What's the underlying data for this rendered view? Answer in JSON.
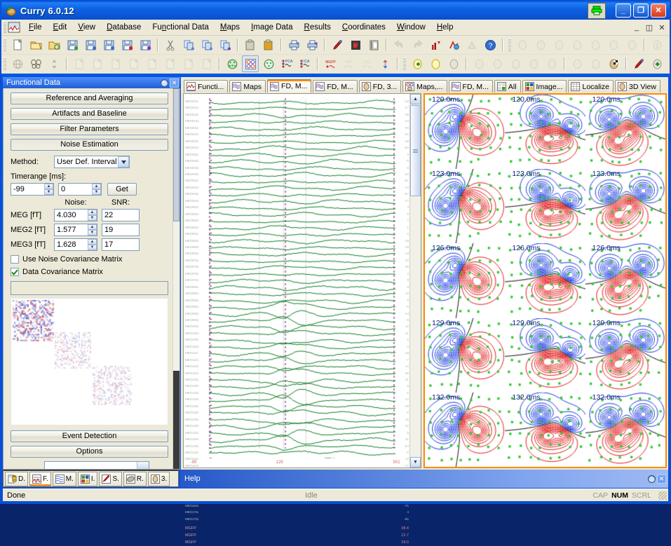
{
  "window": {
    "title": "Curry 6.0.12",
    "icon": "curry-app-icon",
    "print_icon": "printer-icon",
    "minimize": "_",
    "maximize": "❐",
    "close": "✕"
  },
  "menu": {
    "app_icon": "curry-document-icon",
    "items": [
      {
        "label": "File",
        "accel": "F"
      },
      {
        "label": "Edit",
        "accel": "E"
      },
      {
        "label": "View",
        "accel": "V"
      },
      {
        "label": "Database",
        "accel": "D"
      },
      {
        "label": "Functional Data",
        "accel": "n"
      },
      {
        "label": "Maps",
        "accel": "M"
      },
      {
        "label": "Image Data",
        "accel": "I"
      },
      {
        "label": "Results",
        "accel": "R"
      },
      {
        "label": "Coordinates",
        "accel": "C"
      },
      {
        "label": "Window",
        "accel": "W"
      },
      {
        "label": "Help",
        "accel": "H"
      }
    ],
    "window_buttons": [
      "_",
      "❐",
      "✕"
    ]
  },
  "toolbar_row1": [
    "new-document-icon",
    "open-folder-icon",
    "open-search-icon",
    "save-green-icon",
    "save-blue-icon",
    "save-blue2-icon",
    "save-red-icon",
    "save-purple-icon",
    "cut-icon",
    "copy-icon",
    "copy2-icon",
    "copy-purple-icon",
    "paste-icon",
    "paste-gold-icon",
    "print-icon",
    "print-purple-icon",
    "marker-icon",
    "red-hand-icon",
    "filmstrip-icon",
    "undo-icon",
    "redo-icon",
    "chart-red-icon",
    "chart-blue-icon",
    "chart-gray-icon",
    "help-icon",
    "head-rotate-icon",
    "head1-icon",
    "head2-icon",
    "head3-icon",
    "head4-icon",
    "head5-icon",
    "head6-icon",
    "head-num1-icon",
    "head-num2-icon",
    "head-pair1-icon",
    "head-pair2-icon"
  ],
  "toolbar_row2": [
    "globe-gray-icon",
    "butterfly-icon",
    "updown-icon",
    "page-blank-icon",
    "page-left-icon",
    "page-x-icon",
    "page-right-icon",
    "page-dots-icon",
    "page-a-icon",
    "page-b-icon",
    "page-c-icon",
    "sensor-globe-icon",
    "maps-2x2-icon",
    "sensor-green-icon",
    "pca-icon",
    "ica-icon",
    "mgfp-icon",
    "dip-icon",
    "dev-icon",
    "updown-blue-icon",
    "head-plus-yellow-icon",
    "head-yellow-icon",
    "head-x-icon",
    "head-grid1-icon",
    "head-grid2-icon",
    "head-grid3-icon",
    "head-grid4-icon",
    "head-grid5-icon",
    "head-slice1-icon",
    "head-slice2-icon",
    "head-checker-icon",
    "head-marker-icon",
    "head-add-icon",
    "head-pink-icon"
  ],
  "panel": {
    "title": "Functional Data",
    "title_icon": "sphere-icon",
    "close_label": "✕",
    "buttons": [
      {
        "label": "Reference and Averaging",
        "state": "normal"
      },
      {
        "label": "Artifacts and Baseline",
        "state": "normal"
      },
      {
        "label": "Filter Parameters",
        "state": "normal"
      },
      {
        "label": "Noise Estimation",
        "state": "pressed"
      }
    ],
    "method": {
      "label": "Method:",
      "value": "User Def. Interval",
      "dropdown_icon": "chevron-down-icon"
    },
    "timerange": {
      "label": "Timerange [ms]:",
      "from": "-99",
      "to": "0",
      "get_label": "Get"
    },
    "table": {
      "col_noise": "Noise:",
      "col_snr": "SNR:",
      "rows": [
        {
          "label": "MEG [fT]",
          "noise": "4.030",
          "snr": "22"
        },
        {
          "label": "MEG2 [fT]",
          "noise": "1.577",
          "snr": "19"
        },
        {
          "label": "MEG3 [fT]",
          "noise": "1.628",
          "snr": "17"
        }
      ]
    },
    "checkboxes": [
      {
        "label": "Use Noise Covariance Matrix",
        "checked": false
      },
      {
        "label": "Data Covariance Matrix",
        "checked": true
      }
    ],
    "bottom_buttons": [
      {
        "label": "Event Detection"
      },
      {
        "label": "Options"
      }
    ]
  },
  "view_tabs": [
    {
      "label": "Functi...",
      "icon": "functional-data-icon",
      "active": false
    },
    {
      "label": "Maps",
      "icon": "maps-icon",
      "active": false
    },
    {
      "label": "FD, M...",
      "icon": "fd-maps-icon",
      "active": true
    },
    {
      "label": "FD, M...",
      "icon": "fd-maps2-icon",
      "active": false
    },
    {
      "label": "FD, 3...",
      "icon": "fd-3d-icon",
      "active": false
    },
    {
      "label": "Maps,...",
      "icon": "maps-3d-icon",
      "active": false
    },
    {
      "label": "FD, M...",
      "icon": "fd-maps3-icon",
      "active": false
    },
    {
      "label": "All",
      "icon": "all-icon",
      "active": false
    },
    {
      "label": "Image...",
      "icon": "image-data-icon",
      "active": false
    },
    {
      "label": "Localize",
      "icon": "localize-icon",
      "active": false
    },
    {
      "label": "3D View",
      "icon": "3d-view-icon",
      "active": false
    }
  ],
  "waveform": {
    "channel_labels": [
      "MEG0111",
      "MEG0121",
      "MEG0131",
      "MEG0141",
      "MEG0211",
      "MEG0221",
      "MEG0231",
      "MEG0241",
      "MEG0311",
      "MEG0321",
      "MEG0331",
      "MEG0341",
      "MEG0411",
      "MEG0421",
      "MEG0431",
      "MEG0441",
      "MEG0511",
      "MEG0521",
      "MEG0531",
      "MEG0541",
      "MEG0611",
      "MEG0621",
      "MEG0631",
      "MEG0641",
      "MEG0711",
      "MEG0721",
      "MEG0731",
      "MEG0741",
      "MEG0811",
      "MEG0821",
      "MEG0911",
      "MEG0921",
      "MEG0931",
      "MEG0941",
      "MEG1011",
      "MEG1021",
      "MEG1031",
      "MEG1041",
      "MEG1111",
      "MEG1121",
      "MEG1131",
      "MEG1141",
      "MEG1211",
      "MEG1221",
      "MEG1231",
      "MEG1241",
      "MEG1311",
      "MEG1321",
      "MEG1331",
      "MEG1341",
      "MEG1411",
      "MEG1421",
      "MEG1431",
      "MEG1441",
      "MEG1511",
      "MEG1521",
      "MEG1531",
      "MEG1541",
      "MEG1611",
      "MEG1621",
      "MEG1631",
      "MEG1641",
      "MEG1711",
      "MEG1721"
    ],
    "mgfp_labels": [
      "MGFP",
      "MGFP",
      "MGFP"
    ],
    "channel_values": [
      "-22",
      "-27",
      "-38",
      "-34",
      "-29",
      "-21",
      "-48",
      "-62",
      "3",
      "-9",
      "-9",
      "-40",
      "-51",
      "-43",
      "-87",
      "-77",
      "3",
      "6",
      "7",
      "1",
      "-4",
      "-16",
      "-18",
      "-13",
      "33",
      "48",
      "2",
      "9",
      "9",
      "10",
      "8",
      "-6",
      "-14",
      "-9",
      "12",
      "21",
      "5",
      "-3",
      "-19",
      "-7",
      "14",
      "26",
      "31",
      "9",
      "-2",
      "-17",
      "-28",
      "-6",
      "18",
      "22",
      "9",
      "-11",
      "-24",
      "-5",
      "13",
      "27",
      "14",
      "-8",
      "-31",
      "-47",
      "-53",
      "-71",
      "4",
      "-61"
    ],
    "mgfp_values": [
      "38.4",
      "12.7",
      "18.0"
    ],
    "time_axis": [
      {
        "label": "-99",
        "pos": 3
      },
      {
        "label": "129",
        "pos": 41
      },
      {
        "label": "501",
        "pos": 93
      }
    ],
    "cursor_time_pct": 41,
    "trace_color": "#0f7d23",
    "mgfp_color": "#e02020",
    "cursor_color": "#7b1f6e"
  },
  "maps": {
    "accent_color": "#ff8a00",
    "times": [
      [
        "120.0ms",
        "120.0ms",
        "120.0ms"
      ],
      [
        "123.0ms",
        "123.0ms",
        "123.0ms"
      ],
      [
        "126.0ms",
        "126.0ms",
        "126.0ms"
      ],
      [
        "129.0ms",
        "129.0ms",
        "129.0ms"
      ],
      [
        "132.0ms",
        "132.0ms",
        "132.0ms"
      ]
    ],
    "contour_positive": "#e01010",
    "contour_negative": "#1030e0",
    "contour_zero": "#000000",
    "sensor_color": "#32c832"
  },
  "bottom_tabs": [
    {
      "label": "D.",
      "icon": "database-icon",
      "active": false
    },
    {
      "label": "F.",
      "icon": "functional-data-icon",
      "active": true
    },
    {
      "label": "M.",
      "icon": "maps-icon",
      "active": false
    },
    {
      "label": "I.",
      "icon": "image-data-icon",
      "active": false
    },
    {
      "label": "S.",
      "icon": "signal-icon",
      "active": false
    },
    {
      "label": "R.",
      "icon": "results-icon",
      "active": false
    },
    {
      "label": "3.",
      "icon": "3d-icon",
      "active": false
    }
  ],
  "help": {
    "title": "Help",
    "icon": "sphere-icon",
    "close_label": "✕"
  },
  "status": {
    "left": "Done",
    "middle": "Idle",
    "indicators": [
      {
        "label": "CAP",
        "on": false
      },
      {
        "label": "NUM",
        "on": true
      },
      {
        "label": "SCRL",
        "on": false
      }
    ]
  }
}
